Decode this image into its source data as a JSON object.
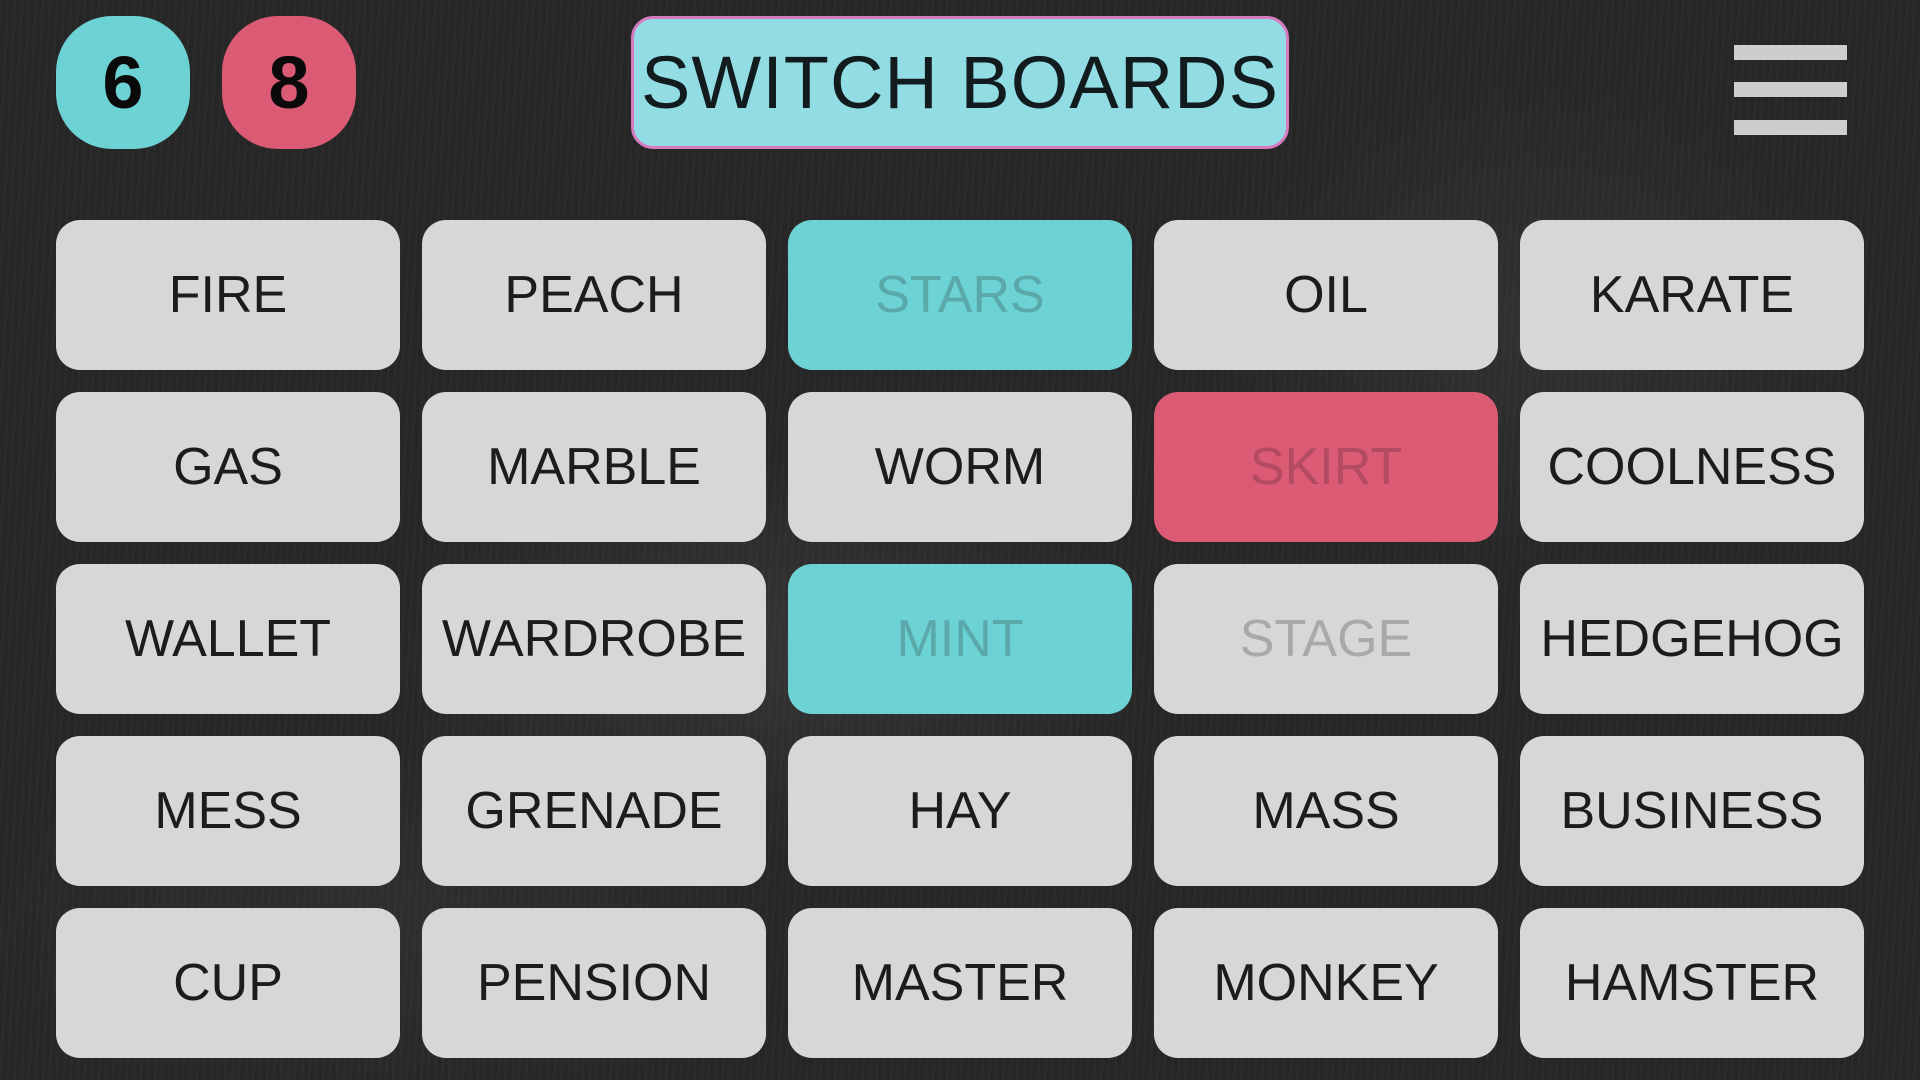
{
  "scores": {
    "blue": {
      "value": "6",
      "color": "#6dd2d4"
    },
    "red": {
      "value": "8",
      "color": "#db5a74"
    }
  },
  "header": {
    "title_button": "SWITCH BOARDS",
    "menu_icon": "hamburger-menu-icon"
  },
  "board": {
    "cards": [
      {
        "word": "FIRE",
        "state": "normal"
      },
      {
        "word": "PEACH",
        "state": "normal"
      },
      {
        "word": "STARS",
        "state": "blue"
      },
      {
        "word": "OIL",
        "state": "normal"
      },
      {
        "word": "KARATE",
        "state": "normal"
      },
      {
        "word": "GAS",
        "state": "normal"
      },
      {
        "word": "MARBLE",
        "state": "normal"
      },
      {
        "word": "WORM",
        "state": "normal"
      },
      {
        "word": "SKIRT",
        "state": "red"
      },
      {
        "word": "COOLNESS",
        "state": "normal"
      },
      {
        "word": "WALLET",
        "state": "normal"
      },
      {
        "word": "WARDROBE",
        "state": "normal"
      },
      {
        "word": "MINT",
        "state": "blue"
      },
      {
        "word": "STAGE",
        "state": "faded"
      },
      {
        "word": "HEDGEHOG",
        "state": "normal"
      },
      {
        "word": "MESS",
        "state": "normal"
      },
      {
        "word": "GRENADE",
        "state": "normal"
      },
      {
        "word": "HAY",
        "state": "normal"
      },
      {
        "word": "MASS",
        "state": "normal"
      },
      {
        "word": "BUSINESS",
        "state": "normal"
      },
      {
        "word": "CUP",
        "state": "normal"
      },
      {
        "word": "PENSION",
        "state": "normal"
      },
      {
        "word": "MASTER",
        "state": "normal"
      },
      {
        "word": "MONKEY",
        "state": "normal"
      },
      {
        "word": "HAMSTER",
        "state": "normal"
      }
    ]
  }
}
